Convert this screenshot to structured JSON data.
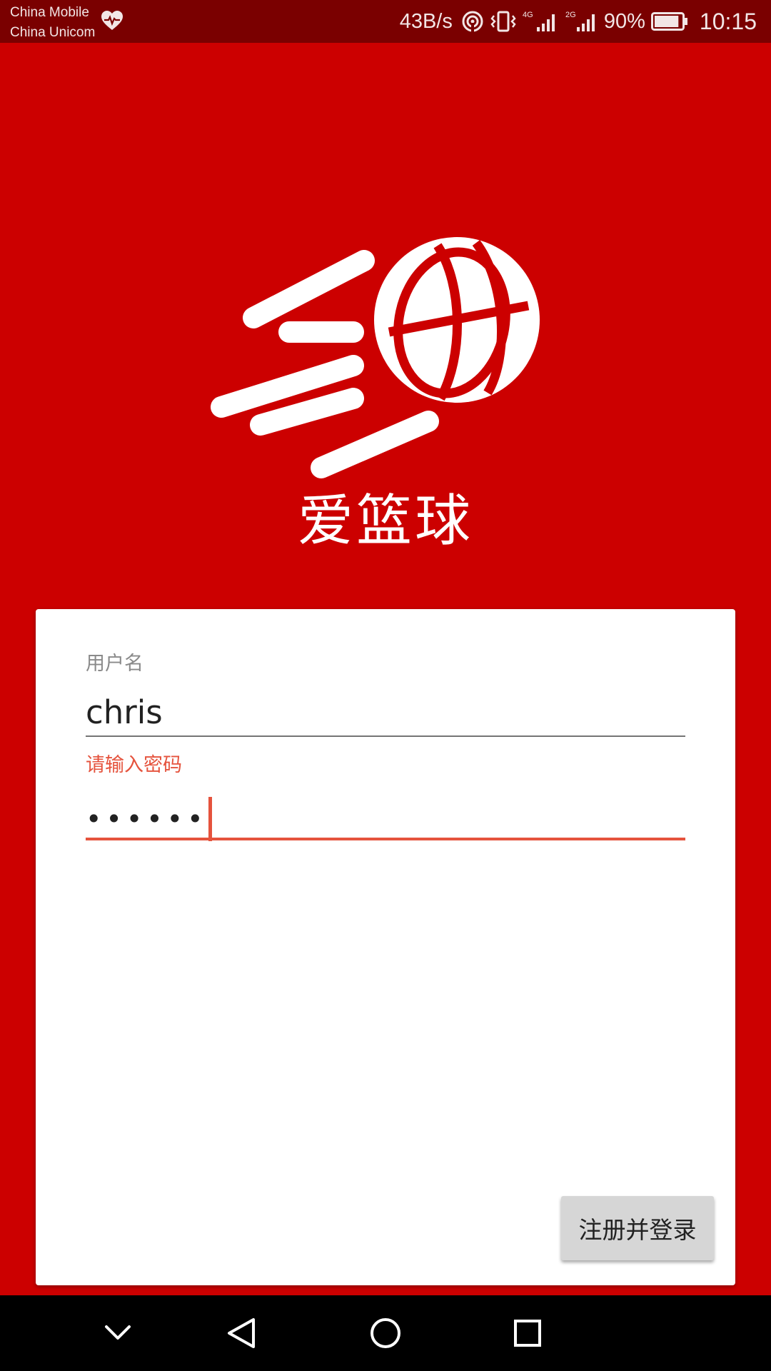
{
  "status_bar": {
    "carrier_1": "China Mobile",
    "carrier_2": "China Unicom",
    "net_speed": "43B/s",
    "net_4g_label": "4G",
    "net_2g_label": "2G",
    "battery_percent": "90%",
    "battery_level": 0.9,
    "time": "10:15",
    "icons": [
      "heart-health-icon",
      "hotspot-icon",
      "vibrate-icon",
      "signal-4g-icon",
      "signal-2g-icon",
      "battery-icon"
    ]
  },
  "app": {
    "title": "爱篮球",
    "logo_icon": "basketball-logo-icon"
  },
  "form": {
    "username_label": "用户名",
    "username_value": "chris",
    "password_label": "请输入密码",
    "password_masked": "••••••",
    "submit_label": "注册并登录"
  },
  "nav_bar": {
    "icons": [
      "chevron-down-icon",
      "back-icon",
      "home-icon",
      "recents-icon"
    ]
  },
  "colors": {
    "background": "#cc0000",
    "status_bar": "#7a0000",
    "accent_error": "#e5533d",
    "card": "#ffffff",
    "button": "#d6d6d6"
  }
}
